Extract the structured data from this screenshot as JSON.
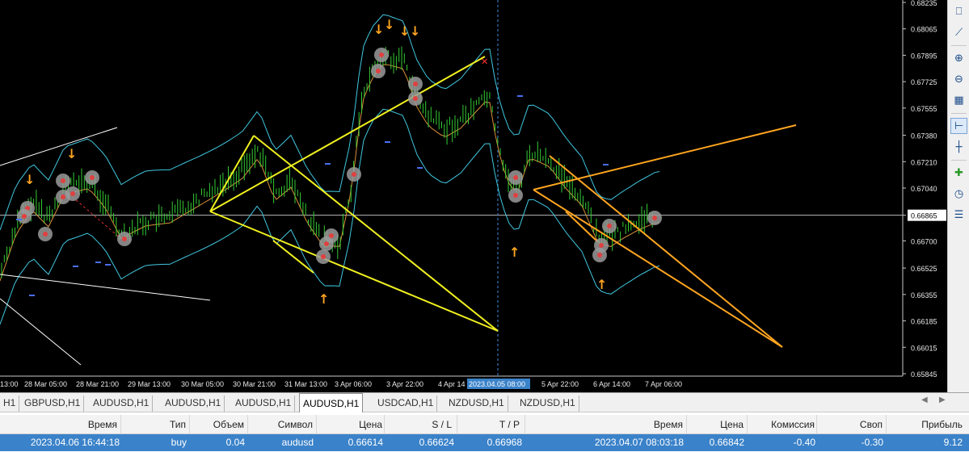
{
  "chart": {
    "background": "#000000",
    "current_price": "0.66865",
    "price_levels": [
      "0.68235",
      "0.68065",
      "0.67895",
      "0.67725",
      "0.67555",
      "0.67380",
      "0.67210",
      "0.67040",
      "0.66865",
      "0.66700",
      "0.66525",
      "0.66355",
      "0.66185",
      "0.66015",
      "0.65845"
    ],
    "time_labels": [
      "13:00",
      "28 Mar 05:00",
      "28 Mar 21:00",
      "29 Mar 13:00",
      "30 Mar 05:00",
      "30 Mar 21:00",
      "31 Mar 13:00",
      "3 Apr 06:00",
      "3 Apr 22:00",
      "4 Apr 14",
      "2023.04.05 08:00",
      "5 Apr 22:00",
      "6 Apr 14:00",
      "7 Apr 06:00"
    ],
    "colors": {
      "candles": "#33cc33",
      "band_outer": "#40c8e0",
      "band_mid": "#d9903a",
      "trend_yellow": "#f0f020",
      "trend_orange": "#ffa520",
      "arrow": "#ffa520",
      "cursor_line": "#3f8ee0",
      "label_bg": "#3a82c9"
    }
  },
  "toolbar": {
    "buttons": [
      "chart-indicators-icon",
      "chart-objects-icon",
      "zoom-in-icon",
      "zoom-out-icon",
      "tile-windows-icon",
      "period-separator-icon",
      "bar-chart-icon",
      "add-indicator-icon",
      "clock-icon",
      "template-icon"
    ]
  },
  "tabs": {
    "items": [
      "H1",
      "GBPUSD,H1",
      "AUDUSD,H1",
      "AUDUSD,H1",
      "AUDUSD,H1",
      "AUDUSD,H1",
      "USDCAD,H1",
      "NZDUSD,H1",
      "NZDUSD,H1"
    ],
    "active_index": 5
  },
  "terminal": {
    "headers": {
      "time": "Время",
      "type": "Тип",
      "volume": "Объем",
      "symbol": "Символ",
      "price": "Цена",
      "sl": "S / L",
      "tp": "T / P",
      "time2": "Время",
      "price2": "Цена",
      "commission": "Комиссия",
      "swap": "Своп",
      "profit": "Прибыль"
    },
    "row": {
      "time": "2023.04.06 16:44:18",
      "type": "buy",
      "volume": "0.04",
      "symbol": "audusd",
      "price": "0.66614",
      "sl": "0.66624",
      "tp": "0.66968",
      "time2": "2023.04.07 08:03:18",
      "price2": "0.66842",
      "commission": "-0.40",
      "swap": "-0.30",
      "profit": "9.12"
    }
  }
}
